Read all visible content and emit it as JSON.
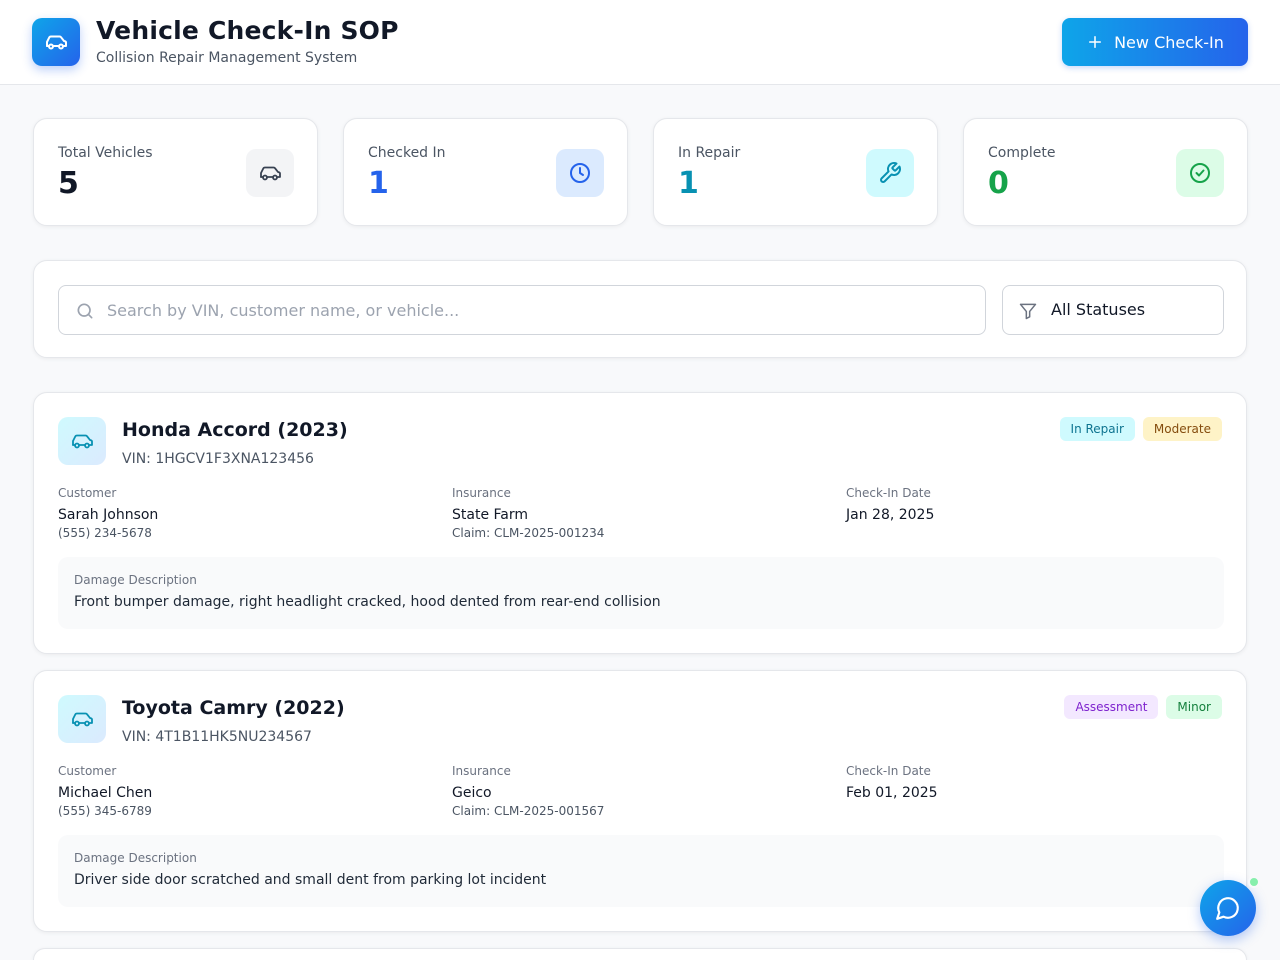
{
  "header": {
    "title": "Vehicle Check-In SOP",
    "subtitle": "Collision Repair Management System",
    "new_button_label": "New Check-In"
  },
  "stats": [
    {
      "label": "Total Vehicles",
      "value": "5",
      "icon": "car-icon",
      "color": "#111827"
    },
    {
      "label": "Checked In",
      "value": "1",
      "icon": "clock-icon",
      "color": "#2563eb"
    },
    {
      "label": "In Repair",
      "value": "1",
      "icon": "wrench-icon",
      "color": "#0891b2"
    },
    {
      "label": "Complete",
      "value": "0",
      "icon": "check-circle-icon",
      "color": "#16a34a"
    }
  ],
  "search": {
    "placeholder": "Search by VIN, customer name, or vehicle...",
    "value": "",
    "status_filter": "All Statuses"
  },
  "labels": {
    "customer": "Customer",
    "insurance": "Insurance",
    "checkin_date": "Check-In Date",
    "damage": "Damage Description"
  },
  "vehicles": [
    {
      "title": "Honda Accord (2023)",
      "vin": "VIN: 1HGCV1F3XNA123456",
      "status": "In Repair",
      "severity": "Moderate",
      "customer_name": "Sarah Johnson",
      "customer_phone": "(555) 234-5678",
      "insurer": "State Farm",
      "claim": "Claim: CLM-2025-001234",
      "checkin_date": "Jan 28, 2025",
      "damage": "Front bumper damage, right headlight cracked, hood dented from rear-end collision"
    },
    {
      "title": "Toyota Camry (2022)",
      "vin": "VIN: 4T1B11HK5NU234567",
      "status": "Assessment",
      "severity": "Minor",
      "customer_name": "Michael Chen",
      "customer_phone": "(555) 345-6789",
      "insurer": "Geico",
      "claim": "Claim: CLM-2025-001567",
      "checkin_date": "Feb 01, 2025",
      "damage": "Driver side door scratched and small dent from parking lot incident"
    }
  ],
  "colors": {
    "accent": "#2563eb",
    "accent_light": "#0ea5e9",
    "status_in_repair_bg": "#cffafe",
    "status_in_repair_fg": "#0e7490",
    "severity_moderate_bg": "#fef3c7",
    "severity_moderate_fg": "#854d0e",
    "status_assessment_bg": "#f3e8ff",
    "status_assessment_fg": "#7e22ce",
    "severity_minor_bg": "#dcfce7",
    "severity_minor_fg": "#15803d"
  }
}
